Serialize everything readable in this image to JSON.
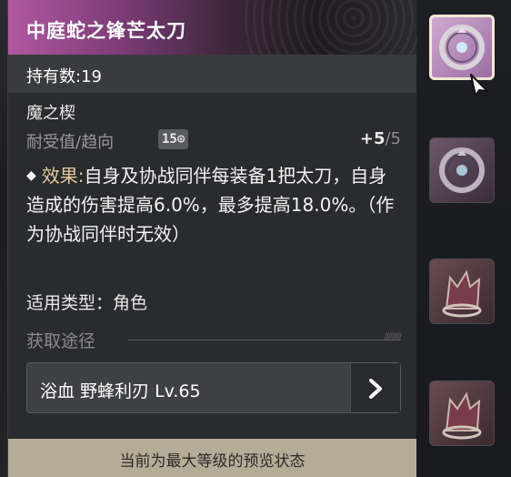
{
  "item": {
    "name": "中庭蛇之锋芒太刀",
    "holding": "持有数:19",
    "type": "魔之楔",
    "durability_label": "耐受值/趋向",
    "durability_badge": "15⊙",
    "durability_value": "+5",
    "durability_max": "/5",
    "effect_prefix": "效果:",
    "effect_text": "自身及协战同伴每装备1把太刀，自身造成的伤害提高6.0%，最多提高18.0%。（作为协战同伴时无效）",
    "apply_type": "适用类型：角色",
    "source_label": "获取途径",
    "source_entry": "浴血 野蜂利刃 Lv.65",
    "footer_note": "当前为最大等级的预览状态"
  },
  "slots": [
    {
      "icon": "serpent-ring-icon",
      "selected": true
    },
    {
      "icon": "serpent-ring-icon",
      "selected": false
    },
    {
      "icon": "wolf-head-icon",
      "selected": false
    },
    {
      "icon": "wolf-head-icon",
      "selected": false
    }
  ],
  "colors": {
    "header_accent": "#b158a2",
    "effect_prefix": "#e2c99b",
    "footer": "#b5ac98"
  }
}
